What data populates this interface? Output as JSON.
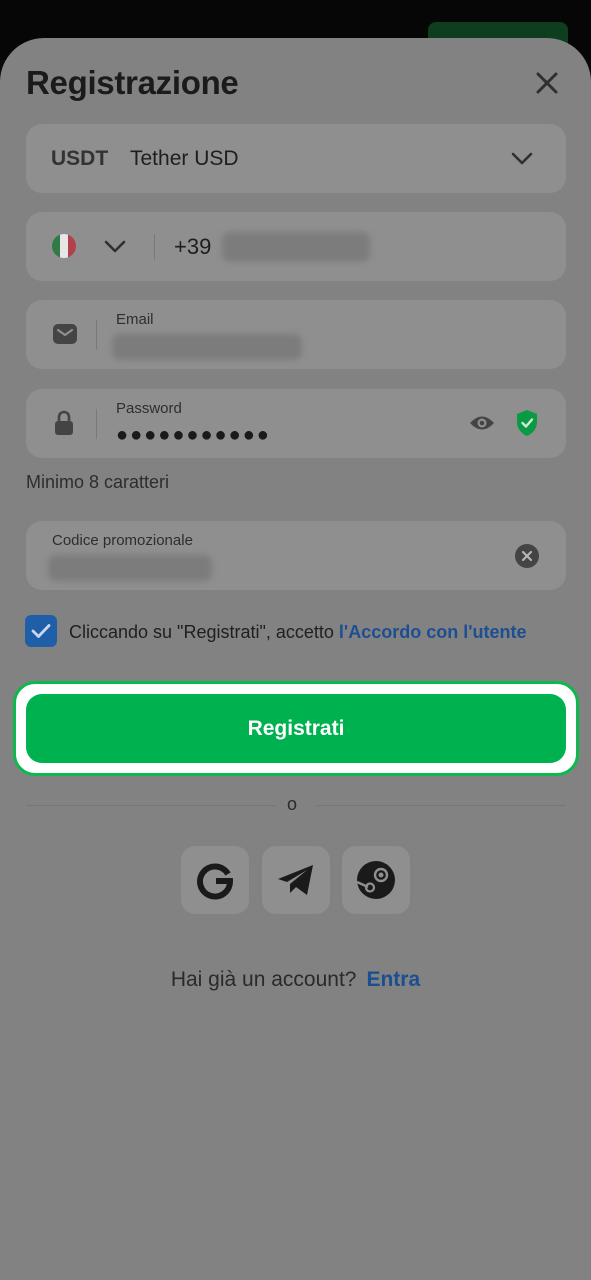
{
  "header": {
    "title": "Registrazione"
  },
  "currency": {
    "code": "USDT",
    "name": "Tether USD"
  },
  "phone": {
    "country_flag": "italy-flag-icon",
    "prefix": "+39"
  },
  "email": {
    "label": "Email"
  },
  "password": {
    "label": "Password",
    "masked_value": "●●●●●●●●●●●",
    "hint": "Minimo 8 caratteri"
  },
  "promo": {
    "label": "Codice promozionale"
  },
  "agreement": {
    "checked": true,
    "text": "Cliccando su \"Registrati\", accetto ",
    "link": "l'Accordo con l'utente"
  },
  "register_button": {
    "label": "Registrati"
  },
  "divider": {
    "label": "o"
  },
  "social": [
    "google-icon",
    "telegram-icon",
    "steam-icon"
  ],
  "footer": {
    "question": "Hai già un account?",
    "link": "Entra"
  },
  "colors": {
    "accent_green": "#00b14f",
    "link_blue": "#1c4f92",
    "sheet": "#828282",
    "field": "#8f8f8f"
  }
}
